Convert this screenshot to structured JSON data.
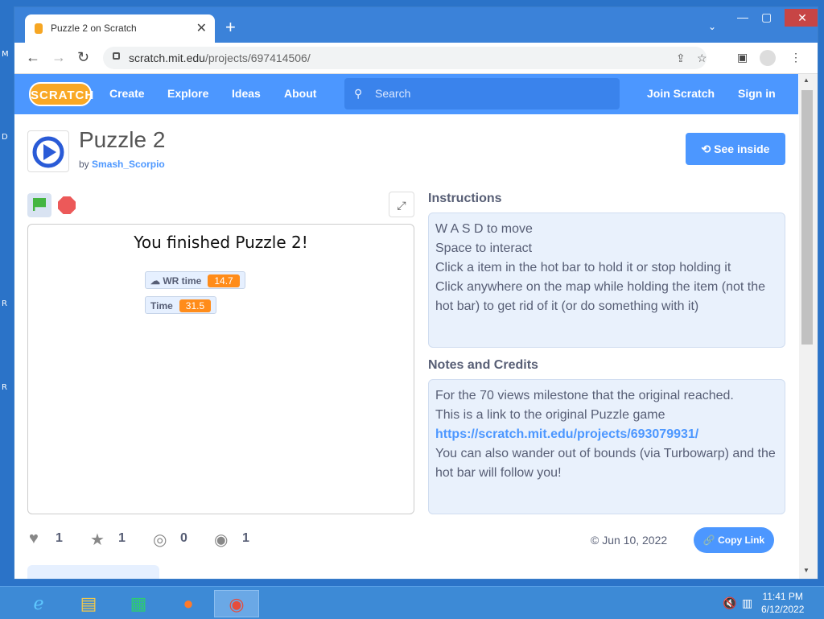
{
  "desktop": {
    "side_letters": [
      "M",
      "D",
      "R",
      "R"
    ]
  },
  "browser": {
    "tab_title": "Puzzle 2 on Scratch",
    "tab_close": "✕",
    "new_tab": "+",
    "url_host": "scratch.mit.edu",
    "url_path": "/projects/697414506/"
  },
  "scratch": {
    "logo_text": "SCRATCH",
    "nav": {
      "create": "Create",
      "explore": "Explore",
      "ideas": "Ideas",
      "about": "About"
    },
    "search_placeholder": "Search",
    "join": "Join Scratch",
    "signin": "Sign in"
  },
  "project": {
    "title": "Puzzle 2",
    "by_label": "by",
    "author": "Smash_Scorpio",
    "see_inside": "See inside",
    "stage_message": "You finished Puzzle 2!",
    "monitors": [
      {
        "label": "☁ WR time",
        "value": "14.7"
      },
      {
        "label": "Time",
        "value": "31.5"
      }
    ],
    "stats": {
      "loves": "1",
      "favorites": "1",
      "remixes": "0",
      "views": "1"
    },
    "date": "© Jun 10, 2022",
    "copy_link": "Copy Link"
  },
  "instructions": {
    "heading": "Instructions",
    "lines": [
      "W A S D to move",
      "Space to interact",
      "Click a item in the hot bar to hold it or stop holding it",
      "Click anywhere on the map while holding the item (not the hot bar) to get rid of it (or do something with it)"
    ]
  },
  "notes": {
    "heading": "Notes and Credits",
    "line1": "For the 70 views milestone that the original reached.",
    "line2": "This is a link to the original Puzzle game",
    "link": "https://scratch.mit.edu/projects/693079931/",
    "line3": "You can also wander out of bounds (via Turbowarp) and the hot bar will follow you!"
  },
  "taskbar": {
    "time": "11:41 PM",
    "date": "6/12/2022"
  }
}
